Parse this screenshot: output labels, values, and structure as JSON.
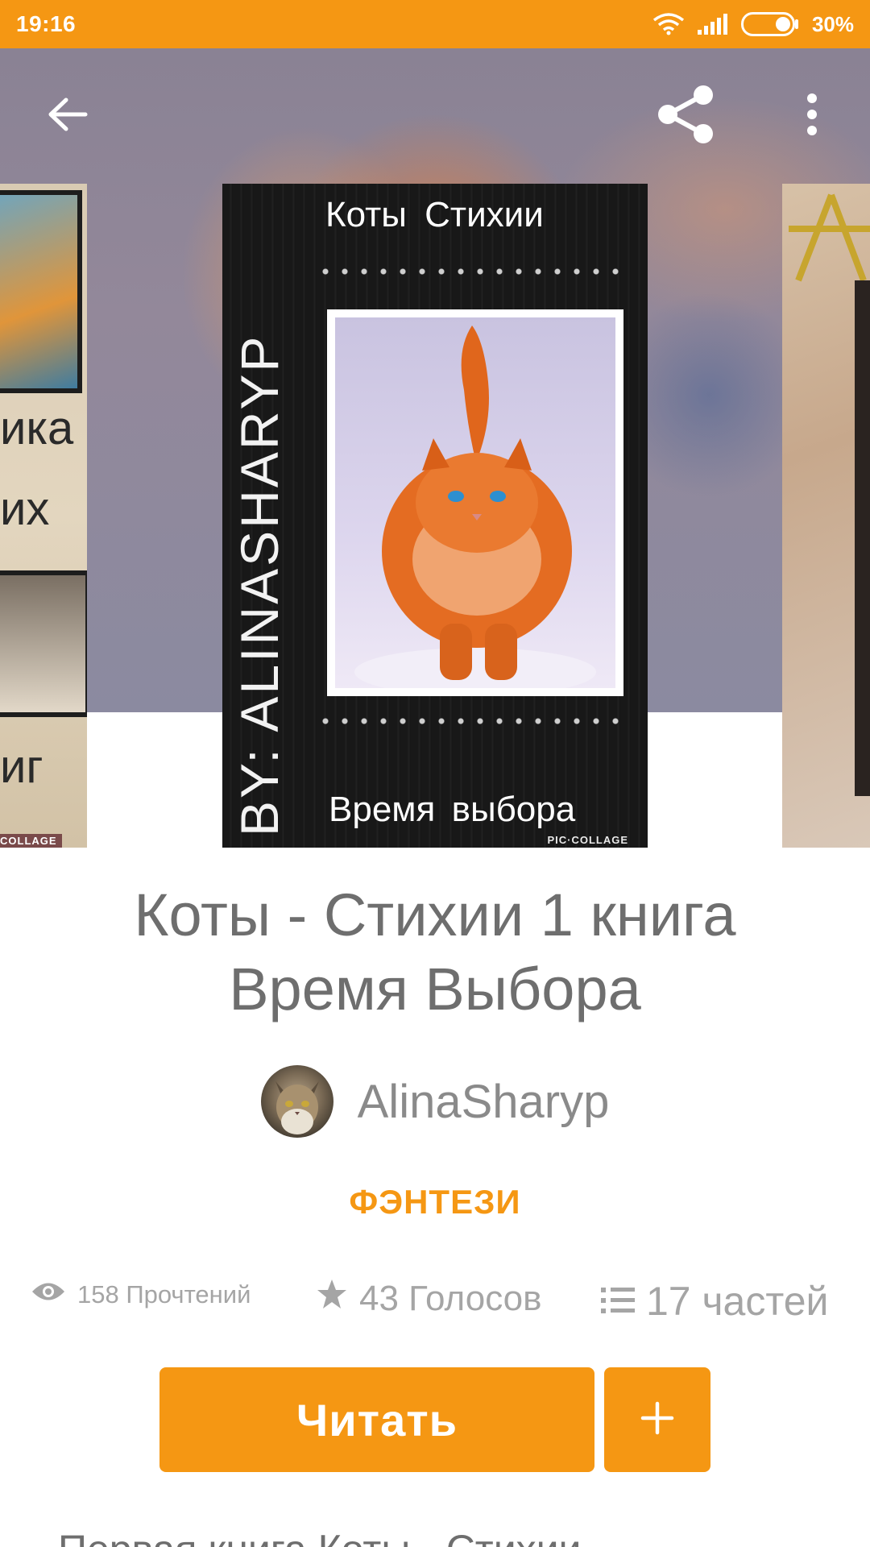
{
  "status_bar": {
    "time": "19:16",
    "battery": "30%",
    "wifi_icon": "wifi-icon",
    "signal_icon": "signal-icon",
    "battery_icon": "battery-icon",
    "color": "#f59713"
  },
  "toolbar": {
    "back_icon": "arrow-left-icon",
    "share_icon": "share-icon",
    "more_icon": "more-vertical-icon"
  },
  "cover": {
    "side_text": "BY: ALINASHARYP",
    "title": "Коты Стихии",
    "subtitle": "Время выбора",
    "credit": "PIC·COLLAGE"
  },
  "neighbor_cover_left": {
    "line1": "ика",
    "line2": "их",
    "line3": "иг",
    "credit": "COLLAGE"
  },
  "book": {
    "title_line1": "Коты - Стихии 1 книга",
    "title_line2": "Время Выбора",
    "author": "AlinaSharyp",
    "genre": "ФЭНТЕЗИ"
  },
  "stats": {
    "reads": "158 Прочтений",
    "reads_icon": "eye-icon",
    "votes": "43 Голосов",
    "votes_icon": "star-icon",
    "parts": "17 частей",
    "parts_icon": "list-icon"
  },
  "actions": {
    "read_label": "Читать",
    "add_icon": "plus-icon"
  },
  "description": {
    "first_line": "Первая книга Коты - Стихии"
  },
  "colors": {
    "accent": "#f59713",
    "text": "#6e6e6e",
    "muted": "#a5a5a5"
  }
}
